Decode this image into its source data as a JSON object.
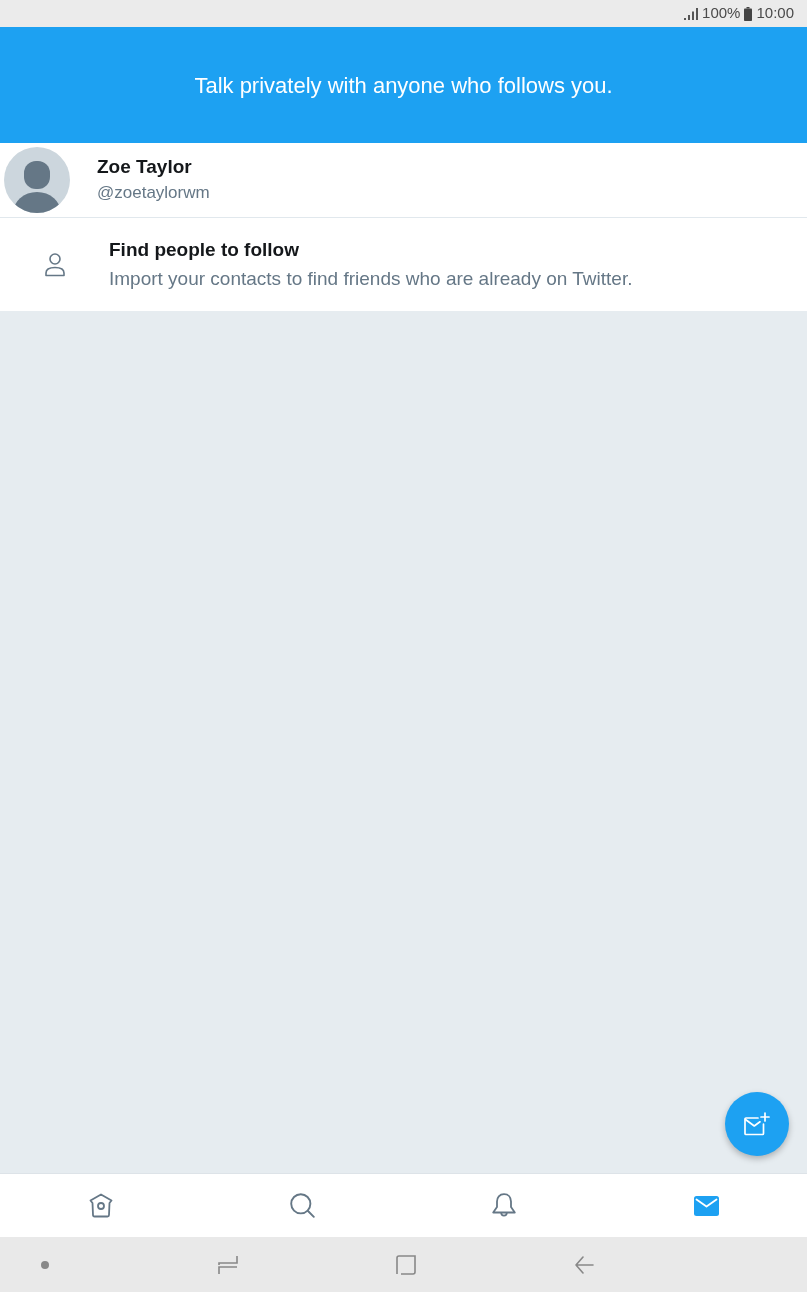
{
  "status_bar": {
    "battery": "100%",
    "time": "10:00"
  },
  "banner": {
    "text": "Talk privately with anyone who follows you."
  },
  "account": {
    "name": "Zoe Taylor",
    "handle": "@zoetaylorwm"
  },
  "suggestion": {
    "title": "Find people to follow",
    "subtitle": "Import your contacts to find friends who are already on Twitter."
  },
  "tabs": [
    {
      "kind": "home",
      "selected": false
    },
    {
      "kind": "search",
      "selected": false
    },
    {
      "kind": "notifications",
      "selected": false
    },
    {
      "kind": "messages",
      "selected": true
    }
  ]
}
